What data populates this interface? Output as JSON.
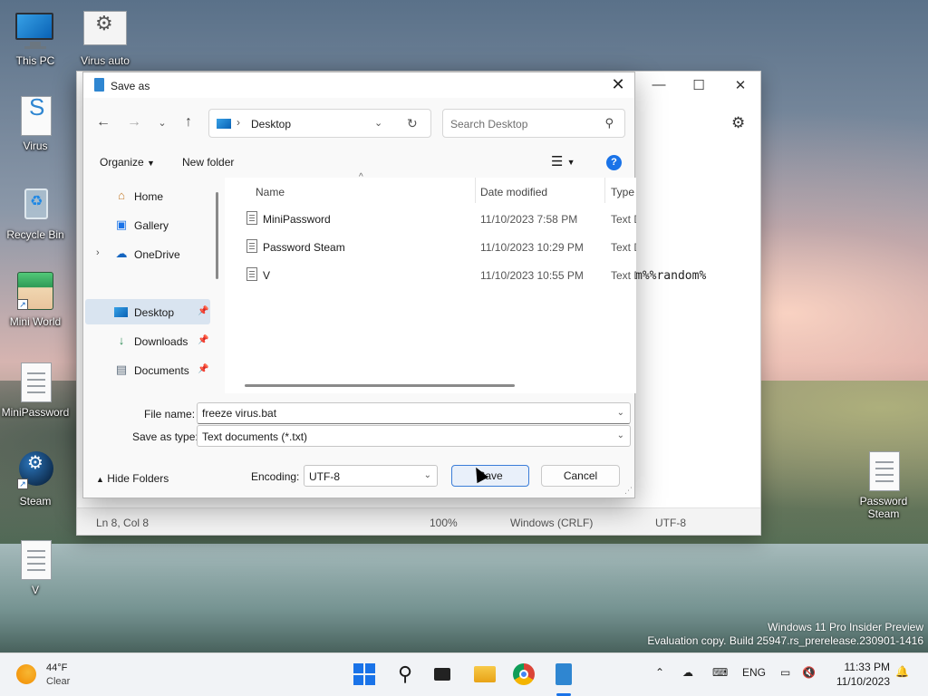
{
  "desktop": {
    "icons": [
      {
        "label": "This PC"
      },
      {
        "label": "Virus auto"
      },
      {
        "label": "Virus"
      },
      {
        "label": "Recycle Bin"
      },
      {
        "label": "Mini World"
      },
      {
        "label": "MiniPassword"
      },
      {
        "label": "Steam"
      },
      {
        "label": "V"
      },
      {
        "label": "Password Steam"
      }
    ]
  },
  "notepad": {
    "window_controls": {
      "minimize": "—",
      "maximize": "☐",
      "close": "✕"
    },
    "visible_text": "m%%random%",
    "status": {
      "position": "Ln 8, Col 8",
      "zoom": "100%",
      "line_ending": "Windows (CRLF)",
      "encoding": "UTF-8"
    }
  },
  "dialog": {
    "title": "Save as",
    "address": {
      "location": "Desktop"
    },
    "search_placeholder": "Search Desktop",
    "commands": {
      "organize": "Organize",
      "new_folder": "New folder"
    },
    "nav": [
      {
        "label": "Home",
        "icon": "home-icon"
      },
      {
        "label": "Gallery",
        "icon": "gallery-icon"
      },
      {
        "label": "OneDrive",
        "icon": "cloud-icon"
      },
      {
        "label": "Desktop",
        "icon": "desktop-icon",
        "selected": true
      },
      {
        "label": "Downloads",
        "icon": "download-icon"
      },
      {
        "label": "Documents",
        "icon": "documents-icon"
      }
    ],
    "columns": {
      "name": "Name",
      "date_modified": "Date modified",
      "type": "Type"
    },
    "files": [
      {
        "name": "MiniPassword",
        "date": "11/10/2023 7:58 PM",
        "type": "Text Document"
      },
      {
        "name": "Password Steam",
        "date": "11/10/2023 10:29 PM",
        "type": "Text Document"
      },
      {
        "name": "V",
        "date": "11/10/2023 10:55 PM",
        "type": "Text Document"
      }
    ],
    "file_name_label": "File name:",
    "file_name_value": "freeze virus.bat",
    "save_type_label": "Save as type:",
    "save_type_value": "Text documents (*.txt)",
    "hide_folders": "Hide Folders",
    "encoding_label": "Encoding:",
    "encoding_value": "UTF-8",
    "save_button": "Save",
    "cancel_button": "Cancel"
  },
  "watermark": {
    "line1": "Windows 11 Pro Insider Preview",
    "line2": "Evaluation copy. Build 25947.rs_prerelease.230901-1416"
  },
  "taskbar": {
    "weather": {
      "temp": "44°F",
      "condition": "Clear"
    },
    "language": "ENG",
    "time": "11:33 PM",
    "date": "11/10/2023"
  }
}
